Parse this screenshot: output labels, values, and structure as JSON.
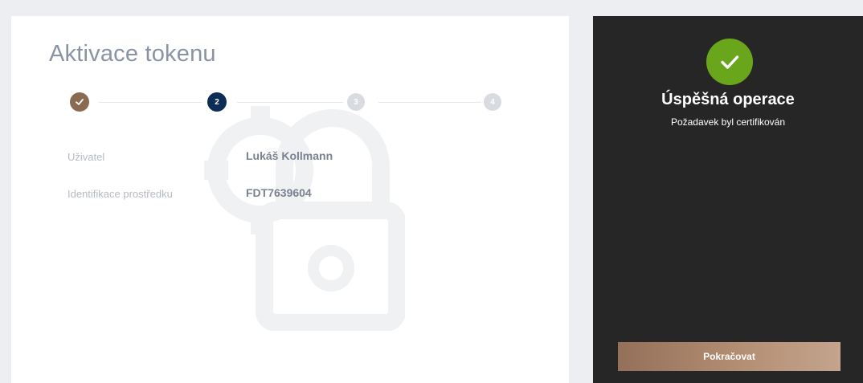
{
  "main": {
    "title": "Aktivace tokenu",
    "stepper": {
      "steps": [
        {
          "label": "",
          "state": "done"
        },
        {
          "label": "2",
          "state": "active"
        },
        {
          "label": "3",
          "state": "pending"
        },
        {
          "label": "4",
          "state": "pending"
        }
      ]
    },
    "fields": [
      {
        "label": "Uživatel",
        "value": "Lukáš Kollmann"
      },
      {
        "label": "Identifikace prostředku",
        "value": "FDT7639604"
      }
    ]
  },
  "side": {
    "icon": "check-icon",
    "title": "Úspěšná operace",
    "subtitle": "Požadavek byl certifikován",
    "continue_label": "Pokračovat"
  },
  "colors": {
    "background": "#eceef2",
    "step_done": "#8a6b51",
    "step_active": "#0e2d54",
    "step_pending": "#d8dbe0",
    "side_panel": "#262626",
    "success": "#6aa61c",
    "button_gradient_start": "#94705a",
    "button_gradient_end": "#c4a48d"
  }
}
